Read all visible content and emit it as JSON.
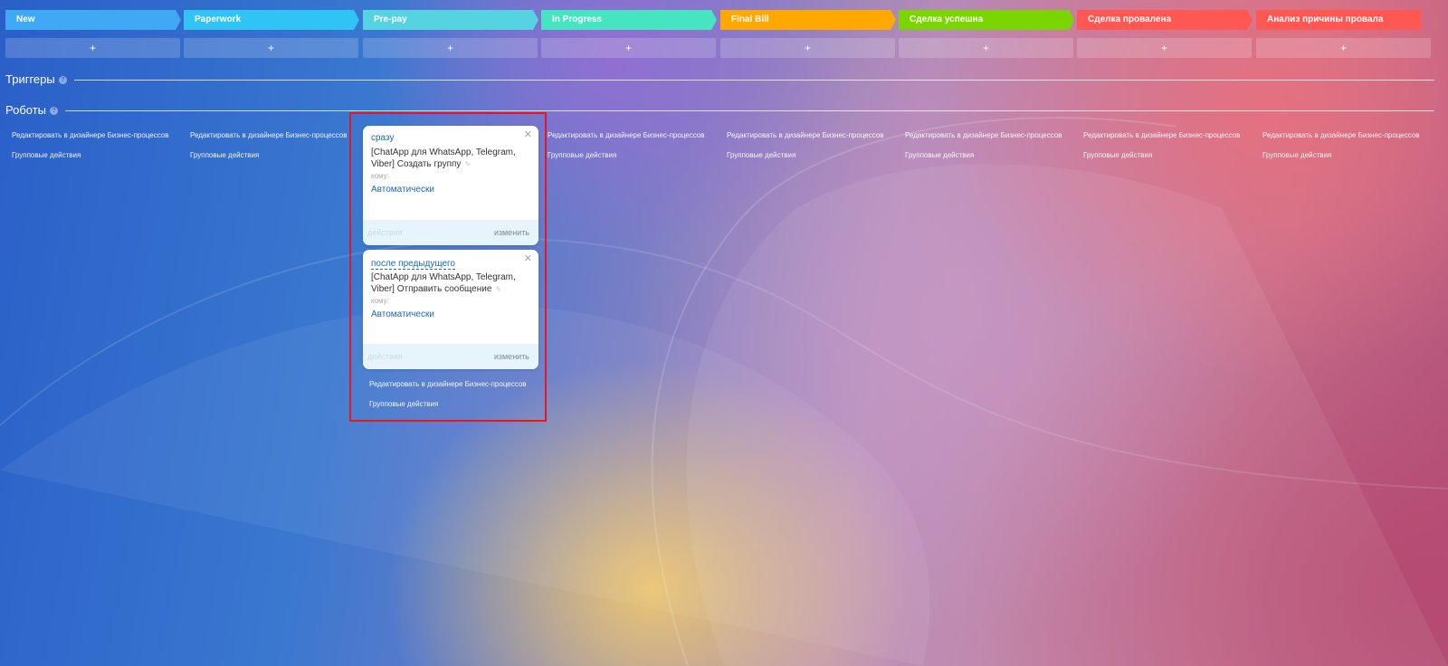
{
  "stages": [
    {
      "label": "New",
      "color": "#3fa9f5",
      "text_color": "#ffffff"
    },
    {
      "label": "Paperwork",
      "color": "#2fc4f4",
      "text_color": "#ffffff"
    },
    {
      "label": "Pre-pay",
      "color": "#56d3e0",
      "text_color": "#ffffff"
    },
    {
      "label": "In Progress",
      "color": "#47e4c2",
      "text_color": "#ffffff"
    },
    {
      "label": "Final Bill",
      "color": "#ffa900",
      "text_color": "#ffffff"
    },
    {
      "label": "Сделка успешна",
      "color": "#7bd500",
      "text_color": "#ffffff"
    },
    {
      "label": "Сделка провалена",
      "color": "#ff5752",
      "text_color": "#ffffff"
    },
    {
      "label": "Анализ причины провала",
      "color": "#ff5752",
      "text_color": "#ffffff"
    }
  ],
  "add_label": "+",
  "sections": {
    "triggers_title": "Триггеры",
    "robots_title": "Роботы",
    "help_glyph": "?"
  },
  "column_links": {
    "edit_designer": "Редактировать в дизайнере Бизнес-процессов",
    "group_actions": "Групповые действия"
  },
  "robots": [
    {
      "trigger": "сразу",
      "description": "[ChatApp для WhatsApp, Telegram, Viber] Создать группу",
      "to_label": "кому:",
      "responsible": "Автоматически",
      "footer_actions": "действия",
      "footer_change": "изменить"
    },
    {
      "trigger": "после предыдущего",
      "description": "[ChatApp для WhatsApp, Telegram, Viber] Отправить сообщение",
      "to_label": "кому:",
      "responsible": "Автоматически",
      "footer_actions": "действия",
      "footer_change": "изменить"
    }
  ],
  "icons": {
    "close": "close-icon",
    "pencil": "pencil-icon",
    "help": "question-icon"
  },
  "colors": {
    "link": "#2067b0",
    "highlight": "#e0182a"
  }
}
